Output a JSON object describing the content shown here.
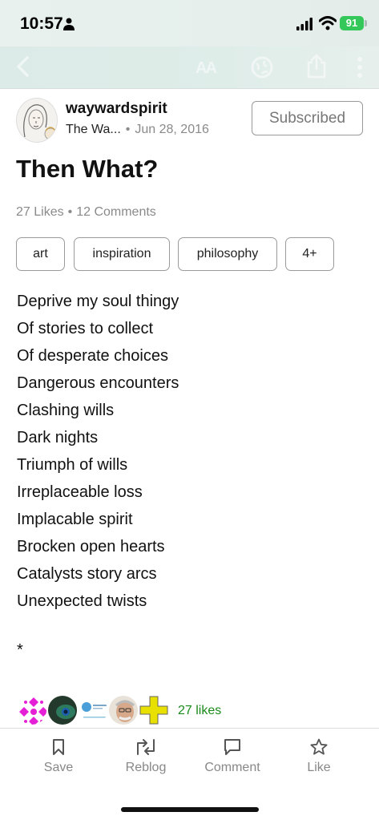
{
  "status_bar": {
    "time": "10:57",
    "battery": "91"
  },
  "colors": {
    "battery_green": "#34c759",
    "likes_green": "#1a8a1a",
    "muted_gray": "#8a8a8a"
  },
  "nav": {
    "textsize_label": "AA",
    "icons": [
      "back-arrow-icon",
      "text-size-icon",
      "globe-icon",
      "share-icon",
      "more-vertical-icon"
    ]
  },
  "post": {
    "author": "waywardspirit",
    "blog_short": "The Wa...",
    "date": "Jun 28, 2016",
    "subscribe_label": "Subscribed",
    "title": "Then What?",
    "likes_text": "27 Likes",
    "comments_text": "12 Comments",
    "tags": [
      {
        "label": "art"
      },
      {
        "label": "inspiration"
      },
      {
        "label": "philosophy"
      },
      {
        "label": "4+"
      }
    ],
    "body_lines": [
      "Deprive my soul thingy",
      "Of stories to collect",
      "Of desperate choices",
      "Dangerous encounters",
      "Clashing wills",
      "Dark nights",
      "Triumph of wills",
      "Irreplaceable loss",
      "Implacable spirit",
      "Brocken open hearts",
      "Catalysts story arcs",
      "Unexpected twists"
    ],
    "asterisk": "*",
    "likes_footer": "27 likes"
  },
  "toolbar": {
    "save": "Save",
    "reblog": "Reblog",
    "comment": "Comment",
    "like": "Like"
  }
}
